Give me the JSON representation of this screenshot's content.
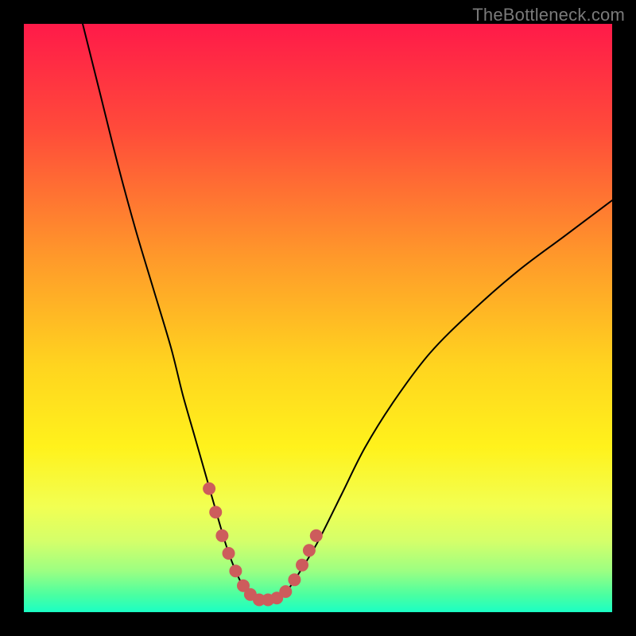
{
  "watermark": "TheBottleneck.com",
  "chart_data": {
    "type": "line",
    "title": "",
    "xlabel": "",
    "ylabel": "",
    "xlim": [
      0,
      100
    ],
    "ylim": [
      0,
      100
    ],
    "background": {
      "type": "vertical-gradient",
      "stops": [
        {
          "offset": 0.0,
          "color": "#ff1a49"
        },
        {
          "offset": 0.18,
          "color": "#ff4b3a"
        },
        {
          "offset": 0.4,
          "color": "#ff9a2a"
        },
        {
          "offset": 0.58,
          "color": "#ffd41f"
        },
        {
          "offset": 0.72,
          "color": "#fff21c"
        },
        {
          "offset": 0.82,
          "color": "#f2ff52"
        },
        {
          "offset": 0.88,
          "color": "#d4ff6a"
        },
        {
          "offset": 0.93,
          "color": "#9cff82"
        },
        {
          "offset": 0.97,
          "color": "#4cffa0"
        },
        {
          "offset": 1.0,
          "color": "#1affc4"
        }
      ]
    },
    "series": [
      {
        "name": "bottleneck-curve",
        "color": "#000000",
        "x": [
          10,
          13,
          16,
          19,
          22,
          25,
          27,
          29,
          31,
          33,
          34.5,
          36,
          37.5,
          39,
          41,
          43,
          45,
          47,
          50,
          54,
          58,
          63,
          69,
          76,
          84,
          92,
          100
        ],
        "y": [
          100,
          88,
          76,
          65,
          55,
          45,
          37,
          30,
          23,
          16,
          11,
          7,
          4,
          2.3,
          2,
          2.3,
          4,
          7,
          12,
          20,
          28,
          36,
          44,
          51,
          58,
          64,
          70
        ]
      }
    ],
    "markers": {
      "name": "valley-markers",
      "color": "#cd5c5c",
      "radius_px": 8,
      "points": [
        {
          "x": 31.5,
          "y": 21
        },
        {
          "x": 32.6,
          "y": 17
        },
        {
          "x": 33.7,
          "y": 13
        },
        {
          "x": 34.8,
          "y": 10
        },
        {
          "x": 36.0,
          "y": 7
        },
        {
          "x": 37.3,
          "y": 4.5
        },
        {
          "x": 38.5,
          "y": 3
        },
        {
          "x": 40.0,
          "y": 2.1
        },
        {
          "x": 41.5,
          "y": 2.1
        },
        {
          "x": 43.0,
          "y": 2.4
        },
        {
          "x": 44.5,
          "y": 3.5
        },
        {
          "x": 46.0,
          "y": 5.5
        },
        {
          "x": 47.3,
          "y": 8
        },
        {
          "x": 48.5,
          "y": 10.5
        },
        {
          "x": 49.7,
          "y": 13
        }
      ]
    }
  }
}
